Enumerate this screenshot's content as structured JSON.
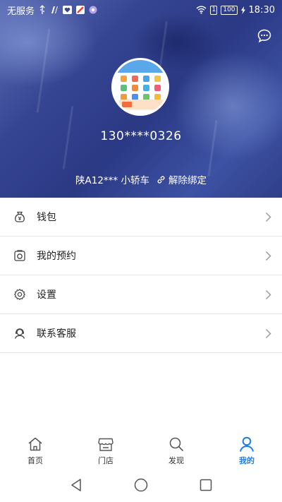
{
  "status_bar": {
    "carrier": "无服务",
    "sim_label": "1",
    "battery": "100",
    "time": "18:30"
  },
  "profile": {
    "phone": "130****0326",
    "plate": "陕A12***",
    "vehicle_type": "小轿车",
    "unbind_label": "解除绑定"
  },
  "menu": {
    "items": [
      {
        "label": "钱包",
        "icon": "wallet-icon"
      },
      {
        "label": "我的预约",
        "icon": "camera-icon"
      },
      {
        "label": "设置",
        "icon": "gear-icon"
      },
      {
        "label": "联系客服",
        "icon": "headset-icon"
      }
    ]
  },
  "tabbar": {
    "tabs": [
      {
        "label": "首页",
        "icon": "home-icon"
      },
      {
        "label": "门店",
        "icon": "store-icon"
      },
      {
        "label": "发现",
        "icon": "search-icon"
      },
      {
        "label": "我的",
        "icon": "user-icon",
        "active": true
      }
    ]
  },
  "colors": {
    "accent": "#1f7fe0",
    "header_bg": "#34438f"
  }
}
